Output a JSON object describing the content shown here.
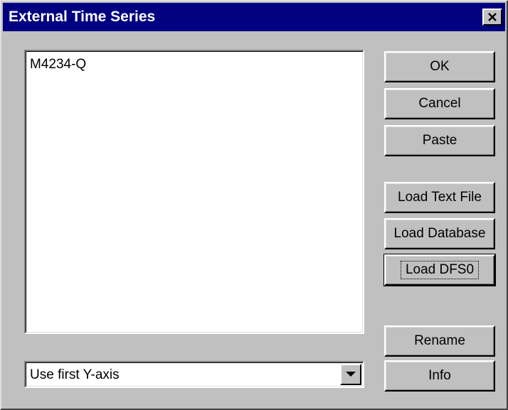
{
  "window": {
    "title": "External Time Series",
    "close_label": "close"
  },
  "list": {
    "items": [
      "M4234-Q"
    ]
  },
  "axis_select": {
    "value": "Use first Y-axis"
  },
  "buttons": {
    "ok": "OK",
    "cancel": "Cancel",
    "paste": "Paste",
    "load_text_file": "Load Text File",
    "load_database": "Load Database",
    "load_dfs0": "Load DFS0",
    "rename": "Rename",
    "info": "Info"
  },
  "colors": {
    "titlebar": "#000080",
    "face": "#c0c0c0"
  }
}
